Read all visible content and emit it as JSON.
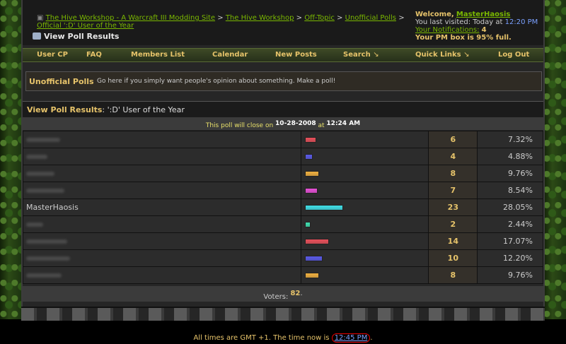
{
  "breadcrumb": {
    "items": [
      "The Hive Workshop - A Warcraft III Modding Site",
      "The Hive Workshop",
      "Off-Topic",
      "Unofficial Polls"
    ],
    "sep": ">",
    "current": "Official ':D' User of the Year"
  },
  "page_title": "View Poll Results",
  "welcome": {
    "label": "Welcome,",
    "username": "MasterHaosis",
    "last_visit": "You last visited: Today at",
    "last_visit_time": "12:20 PM",
    "notifications_label": "Your Notifications:",
    "notifications_count": "4",
    "pm_box": "Your PM box is 95% full."
  },
  "nav": {
    "user_cp": "User CP",
    "faq": "FAQ",
    "members": "Members List",
    "calendar": "Calendar",
    "new_posts": "New Posts",
    "search": "Search",
    "quick_links": "Quick Links",
    "logout": "Log Out",
    "caret": "↘"
  },
  "forum": {
    "name": "Unofficial Polls",
    "description": "Go here if you simply want people's opinion about something. Make a poll!"
  },
  "poll": {
    "header_label": "View Poll Results",
    "header_title": ": ':D' User of the Year",
    "close_text": "This poll will close on",
    "close_date": "10-28-2008",
    "close_at": "at",
    "close_time": "12:24 AM",
    "rows": [
      {
        "name": "",
        "votes": "6",
        "pct": "7.32%",
        "fraction": 0.0732,
        "color": "#e8505a"
      },
      {
        "name": "",
        "votes": "4",
        "pct": "4.88%",
        "fraction": 0.0488,
        "color": "#5a5ae8"
      },
      {
        "name": "",
        "votes": "8",
        "pct": "9.76%",
        "fraction": 0.0976,
        "color": "#f0b040"
      },
      {
        "name": "",
        "votes": "7",
        "pct": "8.54%",
        "fraction": 0.0854,
        "color": "#e850d8"
      },
      {
        "name": "MasterHaosis",
        "votes": "23",
        "pct": "28.05%",
        "fraction": 0.2805,
        "color": "#40e0e8"
      },
      {
        "name": "",
        "votes": "2",
        "pct": "2.44%",
        "fraction": 0.0244,
        "color": "#40e0b0"
      },
      {
        "name": "",
        "votes": "14",
        "pct": "17.07%",
        "fraction": 0.1707,
        "color": "#e8505a"
      },
      {
        "name": "",
        "votes": "10",
        "pct": "12.20%",
        "fraction": 0.122,
        "color": "#5a5ae8"
      },
      {
        "name": "",
        "votes": "8",
        "pct": "9.76%",
        "fraction": 0.0976,
        "color": "#f0b040"
      }
    ],
    "voters_label": "Voters:",
    "voters_count": "82"
  },
  "footer": {
    "text": "All times are GMT +1. The time now is",
    "time": "12:45 PM"
  }
}
